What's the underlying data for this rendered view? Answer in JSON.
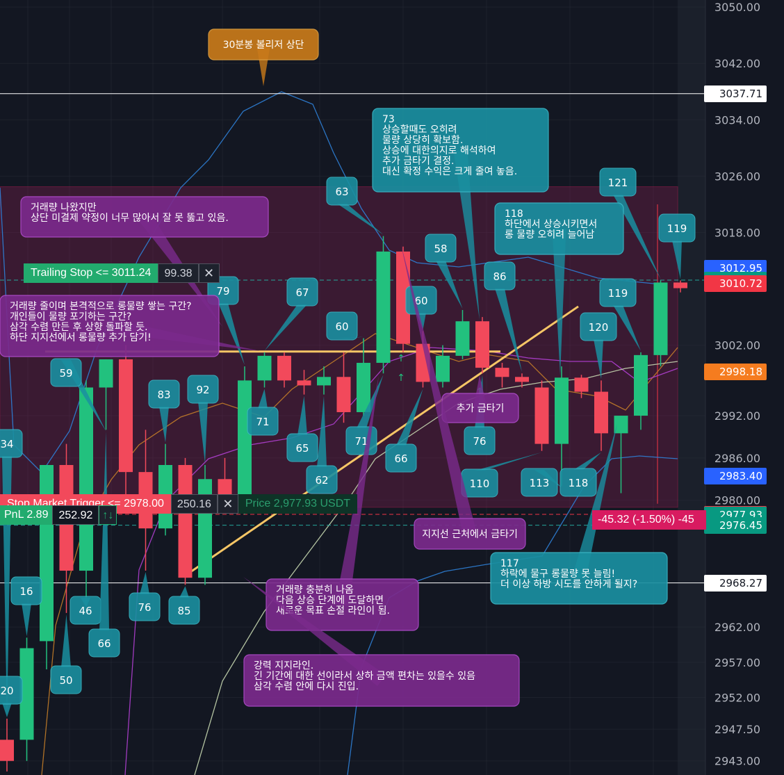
{
  "chart_data": {
    "type": "candlestick",
    "title": "",
    "ylim": [
      2941,
      3051
    ],
    "y_ticks": [
      "3050.00",
      "3042.00",
      "3034.00",
      "3026.00",
      "3018.00",
      "3002.00",
      "2992.00",
      "2986.00",
      "2980.00",
      "2962.00",
      "2957.00",
      "2952.00",
      "2947.50",
      "2943.00"
    ],
    "candles": [
      {
        "o": 2946.0,
        "h": 2949.0,
        "l": 2941.5,
        "c": 2943.0
      },
      {
        "o": 2946.0,
        "h": 2960.5,
        "l": 2943.0,
        "c": 2959.0
      },
      {
        "o": 2960.0,
        "h": 2985.0,
        "l": 2956.0,
        "c": 2985.0
      },
      {
        "o": 2985.0,
        "h": 2988.0,
        "l": 2964.0,
        "c": 2970.0
      },
      {
        "o": 2970.0,
        "h": 2997.0,
        "l": 2965.0,
        "c": 2996.0
      },
      {
        "o": 2996.0,
        "h": 3000.0,
        "l": 2990.0,
        "c": 3000.0
      },
      {
        "o": 3000.0,
        "h": 3002.0,
        "l": 2980.0,
        "c": 2984.0
      },
      {
        "o": 2984.0,
        "h": 2990.0,
        "l": 2970.0,
        "c": 2976.0
      },
      {
        "o": 2976.0,
        "h": 2988.0,
        "l": 2975.0,
        "c": 2985.0
      },
      {
        "o": 2985.0,
        "h": 2986.0,
        "l": 2968.0,
        "c": 2969.0
      },
      {
        "o": 2969.0,
        "h": 2985.0,
        "l": 2968.0,
        "c": 2983.0
      },
      {
        "o": 2983.0,
        "h": 2986.0,
        "l": 2979.0,
        "c": 2980.0
      },
      {
        "o": 2980.0,
        "h": 2999.0,
        "l": 2978.0,
        "c": 2997.0
      },
      {
        "o": 2997.0,
        "h": 3001.0,
        "l": 2996.0,
        "c": 3000.5
      },
      {
        "o": 3000.5,
        "h": 3001.0,
        "l": 2996.0,
        "c": 2997.0
      },
      {
        "o": 2997.0,
        "h": 2998.5,
        "l": 2995.0,
        "c": 2996.3
      },
      {
        "o": 2996.3,
        "h": 2999.0,
        "l": 2995.0,
        "c": 2997.5
      },
      {
        "o": 2997.5,
        "h": 3001.0,
        "l": 2991.0,
        "c": 2992.5
      },
      {
        "o": 2992.5,
        "h": 3003.0,
        "l": 2992.0,
        "c": 2999.5
      },
      {
        "o": 2999.5,
        "h": 3017.5,
        "l": 2998.0,
        "c": 3015.3
      },
      {
        "o": 3015.3,
        "h": 3016.0,
        "l": 3001.0,
        "c": 3002.2
      },
      {
        "o": 3002.2,
        "h": 3004.0,
        "l": 2996.0,
        "c": 2996.8
      },
      {
        "o": 2996.8,
        "h": 3002.0,
        "l": 2996.0,
        "c": 3000.5
      },
      {
        "o": 3000.5,
        "h": 3007.0,
        "l": 3000.0,
        "c": 3005.4
      },
      {
        "o": 3005.4,
        "h": 3006.0,
        "l": 2998.0,
        "c": 2998.8
      },
      {
        "o": 2998.8,
        "h": 2999.5,
        "l": 2996.0,
        "c": 2997.5
      },
      {
        "o": 2997.5,
        "h": 2998.0,
        "l": 2996.0,
        "c": 2996.8
      },
      {
        "o": 2996.0,
        "h": 2997.0,
        "l": 2987.0,
        "c": 2988.0
      },
      {
        "o": 2988.0,
        "h": 2999.0,
        "l": 2982.0,
        "c": 2997.4
      },
      {
        "o": 2997.4,
        "h": 2997.8,
        "l": 2994.5,
        "c": 2995.4
      },
      {
        "o": 2995.4,
        "h": 2997.0,
        "l": 2987.0,
        "c": 2989.5
      },
      {
        "o": 2989.5,
        "h": 2992.0,
        "l": 2981.0,
        "c": 2992.0
      },
      {
        "o": 2992.0,
        "h": 3001.0,
        "l": 2990.0,
        "c": 3000.6
      },
      {
        "o": 3000.6,
        "h": 3011.2,
        "l": 2999.0,
        "c": 3010.9
      },
      {
        "o": 3010.9,
        "h": 3011.2,
        "l": 3009.5,
        "c": 3010.1
      }
    ],
    "price_labels": [
      {
        "price": 3037.71,
        "text": "3037.71",
        "bg": "#ffffff",
        "fg": "#131722"
      },
      {
        "price": 3012.95,
        "text": "3012.95",
        "bg": "#2962ff",
        "fg": "#ffffff"
      },
      {
        "price": 3011.24,
        "text": "3011.24",
        "bg": "#089981",
        "fg": "#ffffff"
      },
      {
        "price": 3010.72,
        "text": "3010.72",
        "bg": "#f23645",
        "fg": "#ffffff"
      },
      {
        "price": 2998.18,
        "text": "2998.18",
        "bg": "#f57c1f",
        "fg": "#ffffff"
      },
      {
        "price": 2983.4,
        "text": "2983.40",
        "bg": "#2962ff",
        "fg": "#ffffff"
      },
      {
        "price": 2978.0,
        "text": "2978.00",
        "bg": "#f23645",
        "fg": "#ffffff"
      },
      {
        "price": 2977.93,
        "text": "2977.93",
        "bg": "#089981",
        "fg": "#ffffff"
      },
      {
        "price": 2976.45,
        "text": "2976.45",
        "bg": "#089981",
        "fg": "#ffffff"
      },
      {
        "price": 2968.27,
        "text": "2968.27",
        "bg": "#ffffff",
        "fg": "#131722"
      }
    ],
    "horizontal_lines": [
      {
        "price": 3037.71,
        "color": "#ffffff",
        "dash": false
      },
      {
        "price": 2968.27,
        "color": "#ffffff",
        "dash": false
      },
      {
        "price": 3011.24,
        "color": "#26a69a",
        "dash": true
      },
      {
        "price": 2978.0,
        "color": "#f23645",
        "dash": true
      },
      {
        "price": 2976.45,
        "color": "#26a69a",
        "dash": true
      }
    ],
    "range_box": {
      "top": 3024.5,
      "bottom": 2979.0,
      "color": "#e91e63"
    },
    "volume_labels": [
      {
        "c": "34",
        "a": 0
      },
      {
        "c": "16",
        "a": 1
      },
      {
        "c": "20",
        "a": 0
      },
      {
        "c": "50",
        "a": 3
      },
      {
        "c": "46",
        "a": 4
      },
      {
        "c": "59",
        "a": 5
      },
      {
        "c": "66",
        "a": 5
      },
      {
        "c": "76",
        "a": 7
      },
      {
        "c": "83",
        "a": 8
      },
      {
        "c": "92",
        "a": 10
      },
      {
        "c": "85",
        "a": 9
      },
      {
        "c": "79",
        "a": 12
      },
      {
        "c": "71",
        "a": 13
      },
      {
        "c": "67",
        "a": 13
      },
      {
        "c": "65",
        "a": 15
      },
      {
        "c": "62",
        "a": 16
      },
      {
        "c": "60",
        "a": 18
      },
      {
        "c": "71",
        "a": 19
      },
      {
        "c": "63",
        "a": 19
      },
      {
        "c": "60",
        "a": 21
      },
      {
        "c": "66",
        "a": 21
      },
      {
        "c": "58",
        "a": 23
      },
      {
        "c": "76",
        "a": 24
      },
      {
        "c": "86",
        "a": 26
      },
      {
        "c": "110",
        "a": 27
      },
      {
        "c": "113",
        "a": 28
      },
      {
        "c": "118",
        "a": 30
      },
      {
        "c": "120",
        "a": 30
      },
      {
        "c": "119",
        "a": 32
      },
      {
        "c": "121",
        "a": 33
      },
      {
        "c": "119",
        "a": 34
      }
    ],
    "notes": [
      {
        "lines": [
          "30분봉 볼리저 상단"
        ]
      },
      {
        "lines": [
          "73",
          "상승할때도 오히려",
          "물량 상당히 확보함.",
          "상승에 대한의지로 해석하여",
          "추가 금타기 결정.",
          "대신 확정 수익은 크게 줄여 놓음."
        ]
      },
      {
        "lines": [
          "거래량 나왔지만",
          "상단 미결제 약정이 너무 많아서 잘 못 뚫고 있음."
        ]
      },
      {
        "lines": [
          "118",
          "하단에서 상승시키면서",
          "롱 물량 오히려 늘어남"
        ]
      },
      {
        "lines": [
          "거래량 줄이며 본격적으로 롱물량 쌓는 구간?",
          "개인들이 물량 포기하는 구간?",
          "삼각 수렴 만든 후 상향 돌파할 듯.",
          "하단 지지선에서 롱물량 추가 담기!"
        ]
      },
      {
        "lines": [
          "추가 금타기"
        ]
      },
      {
        "lines": [
          "지지선 근처에서 금타기"
        ]
      },
      {
        "lines": [
          "117",
          "하락에 물구 롱물량 못 늘림!",
          "더 이상 하방 시도를 안하게 될지?"
        ]
      },
      {
        "lines": [
          "거래량 충분히 나옴",
          "다음 상승 단계에 도달하면",
          "새로운 목표 손절 라인이 됨."
        ]
      },
      {
        "lines": [
          "강력 지지라인.",
          "긴 기간에 대한 선이라서 상하 금액 편차는 있을수 있음",
          "삼각 수렴 안에 다시 진입."
        ]
      }
    ]
  },
  "orders": {
    "trailing_label": "Trailing Stop <= 3011.24",
    "trailing_qty": "99.38",
    "stop_label": "Stop Market Trigger <= 2978.00",
    "stop_qty": "250.16",
    "position_text": "Price 2,977.93 USDT",
    "pnl_label": "PnL 2.89",
    "pnl_qty": "252.92",
    "pnl_arrows": "↑↓",
    "loss_text": "-45.32 (-1.50%) -45",
    "close_glyph": "✕"
  },
  "colors": {
    "up": "#22c17e",
    "down": "#f2495b",
    "bg": "#131722",
    "grid": "#2a2e39",
    "callout": "#1a8fa0",
    "note": "#7b2a8c",
    "orange": "#c97a1a"
  }
}
